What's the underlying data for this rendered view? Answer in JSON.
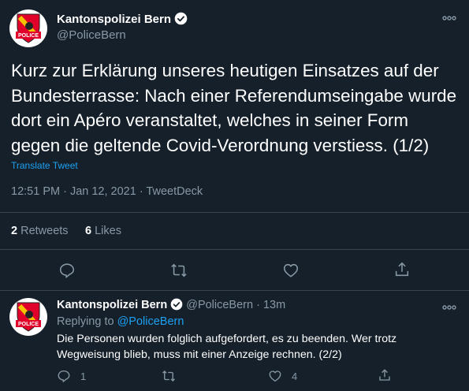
{
  "colors": {
    "background": "#15202b",
    "text": "#ffffff",
    "muted": "#8899a6",
    "link": "#1da1f2",
    "divider": "#38444d",
    "badge_red": "#e0002a"
  },
  "main_tweet": {
    "author_name": "Kantonspolizei Bern",
    "author_handle": "@PoliceBern",
    "avatar_label": "POLICE",
    "more_icon": "ellipsis-icon",
    "text": "Kurz zur Erklärung unseres heutigen Einsatzes auf der Bundesterrasse: Nach einer Referendumseingabe wurde dort ein Apéro veranstaltet, welches in seiner Form gegen die geltende Covid-Verordnung verstiess. (1/2)",
    "translate_label": "Translate Tweet",
    "timestamp": "12:51 PM · Jan 12, 2021 · TweetDeck",
    "stats": {
      "retweets_count": "2",
      "retweets_label": "Retweets",
      "likes_count": "6",
      "likes_label": "Likes"
    },
    "actions": [
      "reply-icon",
      "retweet-icon",
      "like-icon",
      "share-icon"
    ]
  },
  "reply_tweet": {
    "author_name": "Kantonspolizei Bern",
    "author_handle": "@PoliceBern",
    "separator": "·",
    "time_ago": "13m",
    "avatar_label": "POLICE",
    "replying_to_label": "Replying to",
    "replying_to_handle": "@PoliceBern",
    "text": "Die Personen wurden folglich aufgefordert, es zu beenden. Wer trotz Wegweisung blieb, muss mit einer Anzeige rechnen. (2/2)",
    "reply_count": "1",
    "retweet_count": "",
    "like_count": "4",
    "actions": [
      "reply-icon",
      "retweet-icon",
      "like-icon",
      "share-icon"
    ]
  }
}
